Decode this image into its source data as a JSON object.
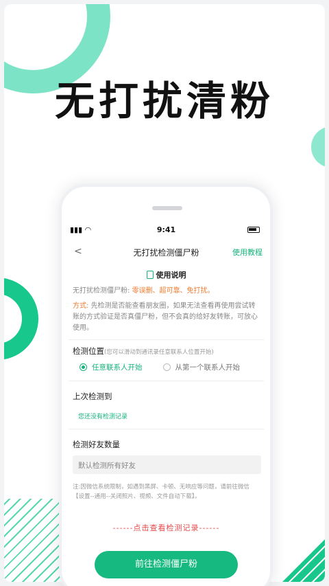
{
  "headline": "无打扰清粉",
  "status_bar": {
    "time": "9:41"
  },
  "nav": {
    "back_label": "<",
    "title": "无打扰检测僵尸粉",
    "help_label": "使用教程"
  },
  "instructions": {
    "heading": "使用说明",
    "intro_prefix": "无打扰检测僵尸粉: ",
    "intro_highlight": "零误删、超可靠、免打扰。",
    "method_label": "方式: ",
    "method_text": "先检测是否能查看朋友圈，如果无法查看再使用尝试转账的方式验证是否真僵尸粉，但不会真的给好友转账，可放心使用。"
  },
  "position": {
    "label": "检测位置",
    "hint": "(您可以滑动到通讯录任意联系人位置开始)",
    "options": [
      {
        "label": "任意联系人开始",
        "selected": true
      },
      {
        "label": "从第一个联系人开始",
        "selected": false
      }
    ]
  },
  "last_check": {
    "label": "上次检测到",
    "empty_text": "您还没有检测记录"
  },
  "friend_count": {
    "label": "检测好友数量",
    "placeholder": "默认检测所有好友"
  },
  "note": "注:因微信系统限制，如遇到黑屏、卡顿、无响应等问题，请前往微信【设置--通用--关闭照片、视频、文件自动下载】。",
  "record_link": "------点击查看检测记录------",
  "cta_label": "前往检测僵尸粉",
  "colors": {
    "accent": "#16b97f",
    "orange": "#f07b2e",
    "red": "#e8484a"
  }
}
